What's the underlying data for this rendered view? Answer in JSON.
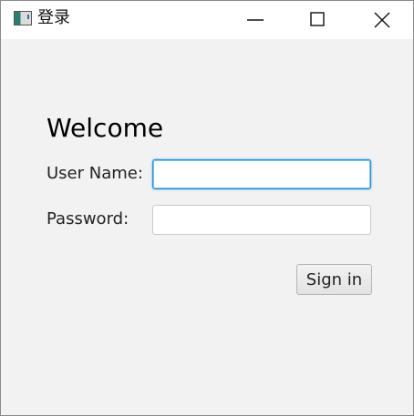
{
  "window": {
    "title": "登录"
  },
  "form": {
    "heading": "Welcome",
    "username_label": "User Name:",
    "username_value": "",
    "password_label": "Password:",
    "password_value": "",
    "submit_label": "Sign in"
  },
  "icons": {
    "app": "app-window-icon",
    "minimize": "minimize-icon",
    "maximize": "maximize-icon",
    "close": "close-icon"
  },
  "colors": {
    "focus_border": "#2b92d5",
    "background": "#f2f2f2"
  }
}
